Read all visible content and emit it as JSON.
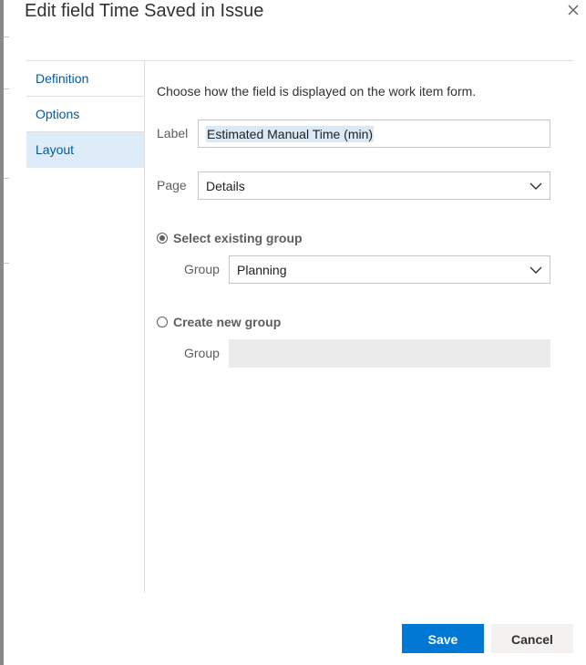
{
  "dialog": {
    "title": "Edit field Time Saved in Issue",
    "close_icon": "close-icon"
  },
  "nav": {
    "items": [
      {
        "label": "Definition",
        "selected": false
      },
      {
        "label": "Options",
        "selected": false
      },
      {
        "label": "Layout",
        "selected": true
      }
    ]
  },
  "layout": {
    "intro": "Choose how the field is displayed on the work item form.",
    "label_field": {
      "label": "Label",
      "value": "Estimated Manual Time (min)"
    },
    "page_field": {
      "label": "Page",
      "value": "Details"
    },
    "existing_group": {
      "label": "Select existing group",
      "checked": true,
      "group_label": "Group",
      "group_value": "Planning"
    },
    "new_group": {
      "label": "Create new group",
      "checked": false,
      "group_label": "Group",
      "group_value": ""
    }
  },
  "footer": {
    "save_label": "Save",
    "cancel_label": "Cancel"
  },
  "colors": {
    "accent": "#0078d4",
    "nav_link": "#005a9e",
    "nav_selected_bg": "#deecf9",
    "text_selection_bg": "#dbe9f7",
    "disabled_input_bg": "#ebebeb"
  }
}
